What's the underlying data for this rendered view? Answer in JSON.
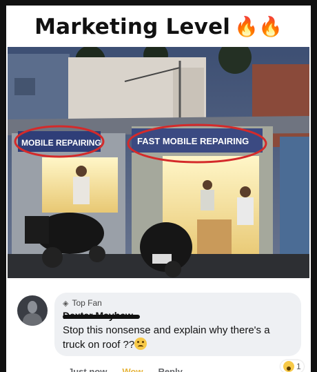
{
  "title": {
    "text": "Marketing Level",
    "emoji": "🔥🔥"
  },
  "photo": {
    "sign_left": "MOBILE REPAIRING",
    "sign_right": "FAST MOBILE REPAIRING"
  },
  "comment": {
    "badge_icon": "diamond-icon",
    "badge": "Top Fan",
    "author": "Dexter Mayhew",
    "text": "Stop this nonsense and explain why there's a truck on roof ??",
    "actions": {
      "time": "Just now",
      "reaction": "Wow",
      "reply": "Reply"
    },
    "reaction_count": "1"
  },
  "colors": {
    "highlight_circle": "#d42a2a",
    "wow": "#e6b43a"
  }
}
